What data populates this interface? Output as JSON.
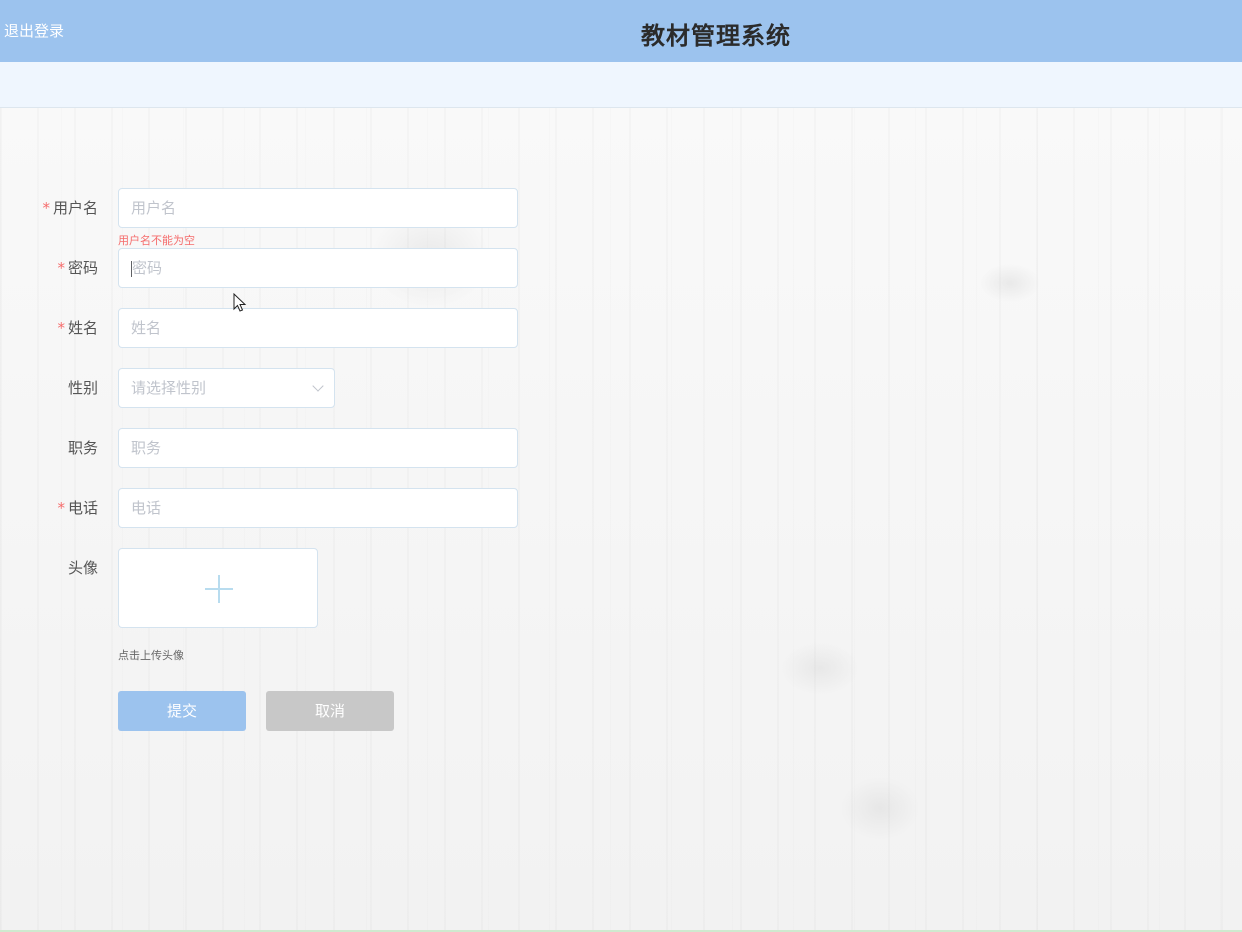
{
  "header": {
    "logout_label": "退出登录",
    "title": "教材管理系统"
  },
  "form": {
    "username": {
      "label": "用户名",
      "placeholder": "用户名",
      "required": true,
      "error": "用户名不能为空"
    },
    "password": {
      "label": "密码",
      "placeholder": "密码",
      "required": true
    },
    "name": {
      "label": "姓名",
      "placeholder": "姓名",
      "required": true
    },
    "gender": {
      "label": "性别",
      "placeholder": "请选择性别",
      "required": false
    },
    "position": {
      "label": "职务",
      "placeholder": "职务",
      "required": false
    },
    "phone": {
      "label": "电话",
      "placeholder": "电话",
      "required": true
    },
    "avatar": {
      "label": "头像",
      "tip": "点击上传头像",
      "icon": "plus-icon"
    },
    "submit_label": "提交",
    "cancel_label": "取消"
  },
  "colors": {
    "header_bg": "#9cc3ee",
    "subbar_bg": "#eff6fe",
    "error": "#f56c6c",
    "submit_bg": "#9cc3ee",
    "cancel_bg": "#c8c8c8"
  }
}
